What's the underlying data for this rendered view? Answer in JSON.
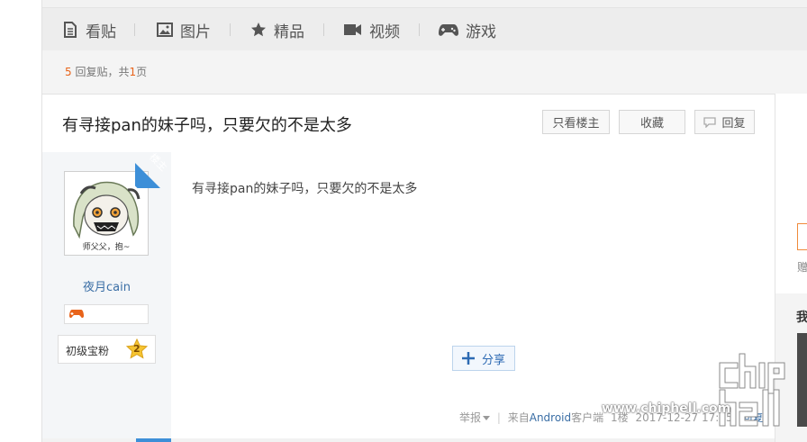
{
  "nav": {
    "items": [
      {
        "label": "看贴",
        "icon": "document-icon"
      },
      {
        "label": "图片",
        "icon": "image-icon"
      },
      {
        "label": "精品",
        "icon": "star-icon"
      },
      {
        "label": "视频",
        "icon": "video-icon"
      },
      {
        "label": "游戏",
        "icon": "gamepad-icon"
      }
    ]
  },
  "reply_summary": {
    "count": "5",
    "mid": " 回复贴，共",
    "pages": "1",
    "suffix": "页"
  },
  "thread": {
    "title": "有寻接pan的妹子吗，只要欠的不是太多",
    "buttons": {
      "only_op": "只看楼主",
      "favorite": "收藏",
      "reply": "回复"
    }
  },
  "post": {
    "op_badge": "楼主",
    "author": "夜月cain",
    "avatar_caption": "师父父，抱~",
    "level_title": "初级宝粉",
    "level_number": "2",
    "content": "有寻接pan的妹子吗，只要欠的不是太多",
    "share_label": "分享",
    "report": "举报",
    "source_prefix": "来自",
    "source_client": "Android",
    "source_suffix": "客户端",
    "floor": "1楼",
    "timestamp": "2017-12-27 17:45",
    "reply_link": "回复"
  },
  "right_panel": {
    "text1": "赠",
    "text2": "我"
  },
  "watermark": {
    "url": "www.chiphell.com",
    "logo": "chiphell"
  },
  "colors": {
    "accent_blue": "#3d8fd8",
    "orange": "#e8631a",
    "link": "#3a6ea5"
  }
}
